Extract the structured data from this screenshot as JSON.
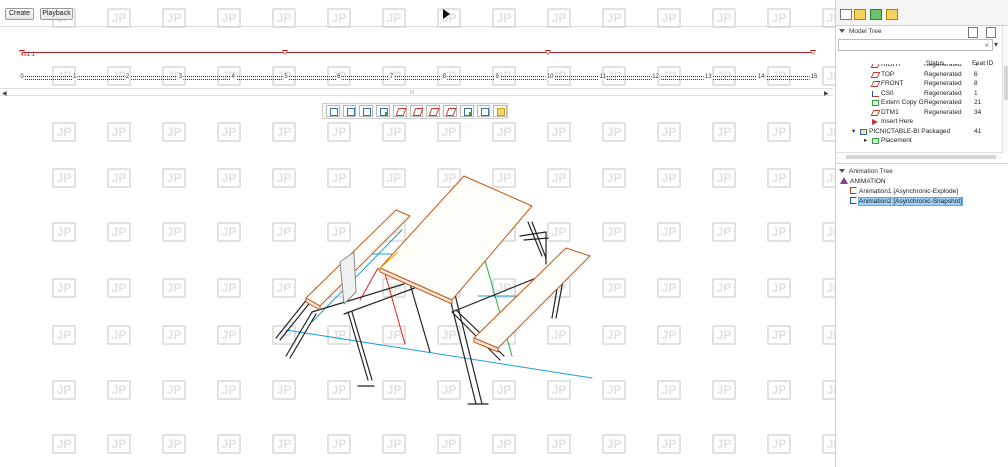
{
  "toolbar": {
    "create_label": "Create",
    "playback_label": "Playback",
    "play_icon": "play-icon"
  },
  "timeline": {
    "label": "ts1.1",
    "ticks": [
      "0",
      "1",
      "2",
      "3",
      "4",
      "5",
      "6",
      "7",
      "8",
      "9",
      "10",
      "11",
      "12",
      "13",
      "14",
      "15"
    ],
    "keyframe_times": [
      5,
      10,
      15
    ],
    "track_color": "#b22222",
    "scroll_grip": "III"
  },
  "view_toolbar": {
    "icons": [
      "zoom-fit-icon",
      "refit-icon",
      "orient-icon",
      "saved-views-icon",
      "display-style-icon",
      "datum-planes-icon",
      "datum-axes-icon",
      "datum-points-icon",
      "csys-icon",
      "spin-center-icon",
      "annotation-icon"
    ]
  },
  "model_tree": {
    "header": "Model Tree",
    "search_placeholder": "",
    "clear_glyph": "×",
    "columns": {
      "name": "",
      "status": "Status",
      "feat_id": "Feat ID"
    },
    "rows": [
      {
        "name": "RIGHT",
        "status": "Regenerated",
        "feat_id": "4",
        "icon": "plane",
        "indent": 1
      },
      {
        "name": "TOP",
        "status": "Regenerated",
        "feat_id": "6",
        "icon": "plane",
        "indent": 1
      },
      {
        "name": "FRONT",
        "status": "Regenerated",
        "feat_id": "8",
        "icon": "plane",
        "indent": 1
      },
      {
        "name": "CS0",
        "status": "Regenerated",
        "feat_id": "1",
        "icon": "csys",
        "indent": 1
      },
      {
        "name": "Extern Copy G",
        "status": "Regenerated",
        "feat_id": "21",
        "icon": "copy",
        "indent": 1
      },
      {
        "name": "DTM1",
        "status": "Regenerated",
        "feat_id": "34",
        "icon": "plane",
        "indent": 1
      },
      {
        "name": "Insert Here",
        "status": "",
        "feat_id": "",
        "icon": "arrow",
        "indent": 1
      },
      {
        "name": "PICNICTABLE-BI Packaged",
        "status": "",
        "feat_id": "41",
        "icon": "asm",
        "indent": 0
      },
      {
        "name": "Placement",
        "status": "",
        "feat_id": "",
        "icon": "place",
        "indent": 1
      }
    ]
  },
  "animation_tree": {
    "header": "Animation Tree",
    "root": "ANIMATION",
    "items": [
      {
        "label": "Animation1 [Asynchronic-Explode]",
        "selected": false,
        "icon": "expl"
      },
      {
        "label": "Animation2 [Asynchronic-Snapshot]",
        "selected": true,
        "icon": "snap"
      }
    ]
  },
  "colors": {
    "accent_selection": "#9fd1f7",
    "keyframe": "#b22222",
    "table_outline": "#c05a1a",
    "track_cyan": "#1aa0d8",
    "track_green": "#2aa84a",
    "track_yellow": "#e5a800"
  }
}
